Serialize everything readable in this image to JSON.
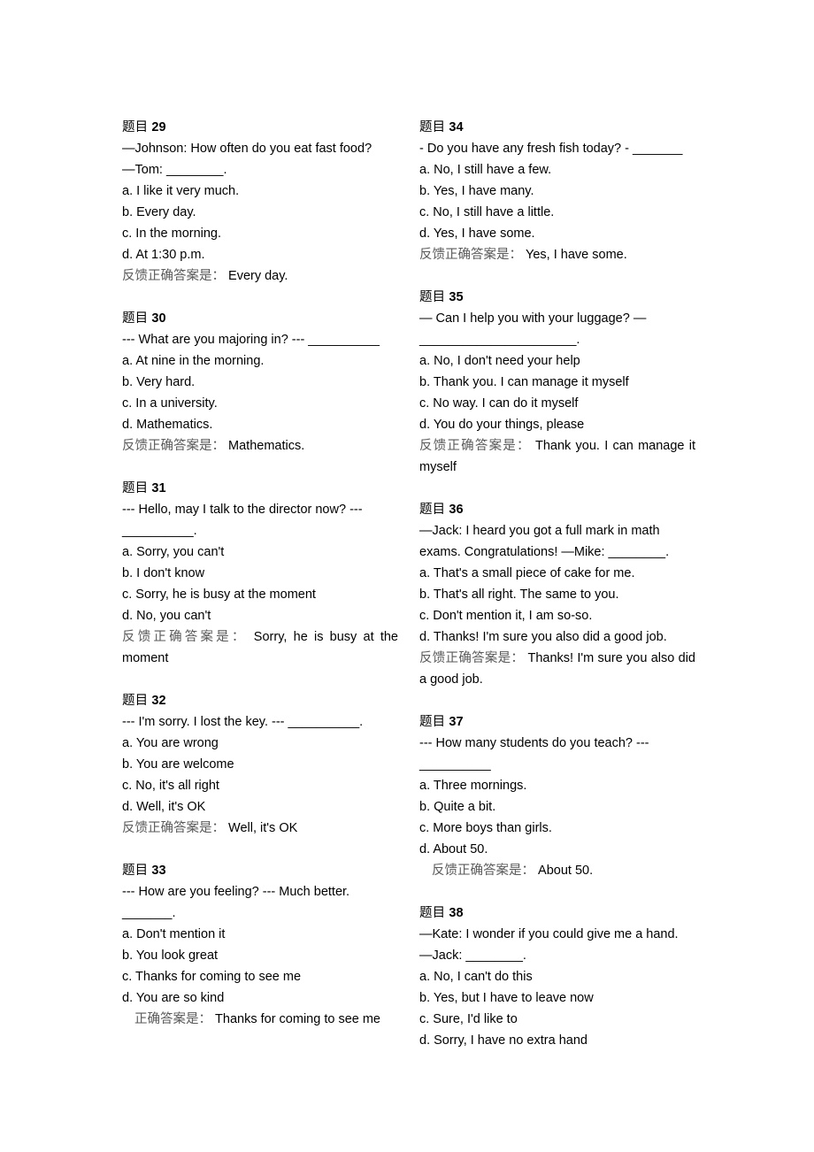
{
  "document": {
    "label_question": "题目",
    "label_answer_feedback": "反馈正确答案是：",
    "label_answer_plain": "正确答案是："
  },
  "columns": {
    "left": [
      {
        "head_label": "题目",
        "head_number": "29",
        "stem": "—Johnson: How often do you eat fast food? —Tom: ________.",
        "stem_lines": [
          "—Johnson: How often do you eat fast food?",
          "—Tom: ________."
        ],
        "options": [
          "a. I like it very much.",
          "b. Every day.",
          "c. In the morning.",
          "d. At 1:30 p.m."
        ],
        "answer_label": "反馈正确答案是：",
        "answer_value": "Every day.",
        "answer_indent": false,
        "justify": false
      },
      {
        "head_label": "题目",
        "head_number": "30",
        "stem": "--- What are you majoring in? --- __________",
        "stem_lines": [
          "--- What are you majoring in? --- __________"
        ],
        "options": [
          "a. At nine in the morning.",
          "b. Very hard.",
          "c. In a university.",
          "d. Mathematics."
        ],
        "answer_label": "反馈正确答案是：",
        "answer_value": "Mathematics.",
        "answer_indent": false,
        "justify": false
      },
      {
        "head_label": "题目",
        "head_number": "31",
        "stem": "--- Hello, may I talk to the director now? --- __________.",
        "stem_lines": [
          "--- Hello, may I talk to the director now? ---",
          "__________."
        ],
        "options": [
          "a. Sorry, you can't",
          "b. I don't know",
          "c. Sorry, he is busy at the moment",
          "d. No, you can't"
        ],
        "answer_label": "反馈正确答案是：",
        "answer_value": "Sorry, he is busy at the moment",
        "answer_indent": false,
        "justify": true
      },
      {
        "head_label": "题目",
        "head_number": "32",
        "stem": "--- I'm sorry. I lost the key. --- __________.",
        "stem_lines": [
          "--- I'm sorry. I lost the key. --- __________."
        ],
        "options": [
          "a. You are wrong",
          "b. You are welcome",
          "c. No, it's all right",
          "d. Well, it's OK"
        ],
        "answer_label": "反馈正确答案是：",
        "answer_value": "Well, it's OK",
        "answer_indent": false,
        "justify": false
      },
      {
        "head_label": "题目",
        "head_number": "33",
        "stem": "--- How are you feeling? --- Much better. _______.",
        "stem_lines": [
          "--- How are you feeling? --- Much better.",
          "_______."
        ],
        "options": [
          "a. Don't mention it",
          "b. You look great",
          "c. Thanks for coming to see me",
          "d. You are so kind"
        ],
        "answer_label": "正确答案是：",
        "answer_value": "Thanks for coming to see me",
        "answer_indent": true,
        "justify": true
      }
    ],
    "right": [
      {
        "head_label": "题目",
        "head_number": "34",
        "stem": "- Do you have any fresh fish today? - _______",
        "stem_lines": [
          "- Do you have any fresh fish today? - _______"
        ],
        "options": [
          "a. No, I still have a few.",
          "b. Yes, I have many.",
          "c. No, I still have a little.",
          "d. Yes, I have some."
        ],
        "answer_label": "反馈正确答案是：",
        "answer_value": "Yes, I have some.",
        "answer_indent": false,
        "justify": false
      },
      {
        "head_label": "题目",
        "head_number": "35",
        "stem": "— Can I help you with your luggage? — ______________________.",
        "stem_lines": [
          "— Can I help you with your luggage? —",
          "______________________."
        ],
        "options": [
          "a. No, I don't need your help",
          "b. Thank you. I can manage it myself",
          "c. No way. I can do it myself",
          "d. You do your things, please"
        ],
        "answer_label": "反馈正确答案是：",
        "answer_value": "Thank you. I can manage it myself",
        "answer_indent": false,
        "justify": true
      },
      {
        "head_label": "题目",
        "head_number": "36",
        "stem": "—Jack: I heard you got a full mark in math exams. Congratulations! —Mike: ________.",
        "stem_lines": [
          "—Jack: I heard you got a full mark in math",
          "exams. Congratulations! —Mike: ________."
        ],
        "options": [
          "a. That's a small piece of cake for me.",
          "b. That's all right. The same to you.",
          "c. Don't mention it, I am so-so.",
          "d. Thanks! I'm sure you also did a good job."
        ],
        "answer_label": "反馈正确答案是：",
        "answer_value": "Thanks! I'm sure you also did a good job.",
        "answer_indent": false,
        "justify": true
      },
      {
        "head_label": "题目",
        "head_number": "37",
        "stem": "--- How many students do you teach? --- __________",
        "stem_lines": [
          "--- How many students do you teach? ---",
          "__________"
        ],
        "options": [
          "a. Three mornings.",
          "b. Quite a bit.",
          "c. More boys than girls.",
          "d. About 50."
        ],
        "answer_label": "反馈正确答案是：",
        "answer_value": "About 50.",
        "answer_indent": true,
        "justify": true
      },
      {
        "head_label": "题目",
        "head_number": "38",
        "stem": "—Kate: I wonder if you could give me a hand. —Jack: ________.",
        "stem_lines": [
          "—Kate: I wonder if you could give me a hand.",
          "—Jack: ________."
        ],
        "options": [
          "a. No, I can't do this",
          "b. Yes, but I have to leave now",
          "c. Sure, I'd like to",
          "d. Sorry, I have no extra hand"
        ],
        "answer_label": null,
        "answer_value": null,
        "answer_indent": false,
        "justify": false
      }
    ]
  }
}
